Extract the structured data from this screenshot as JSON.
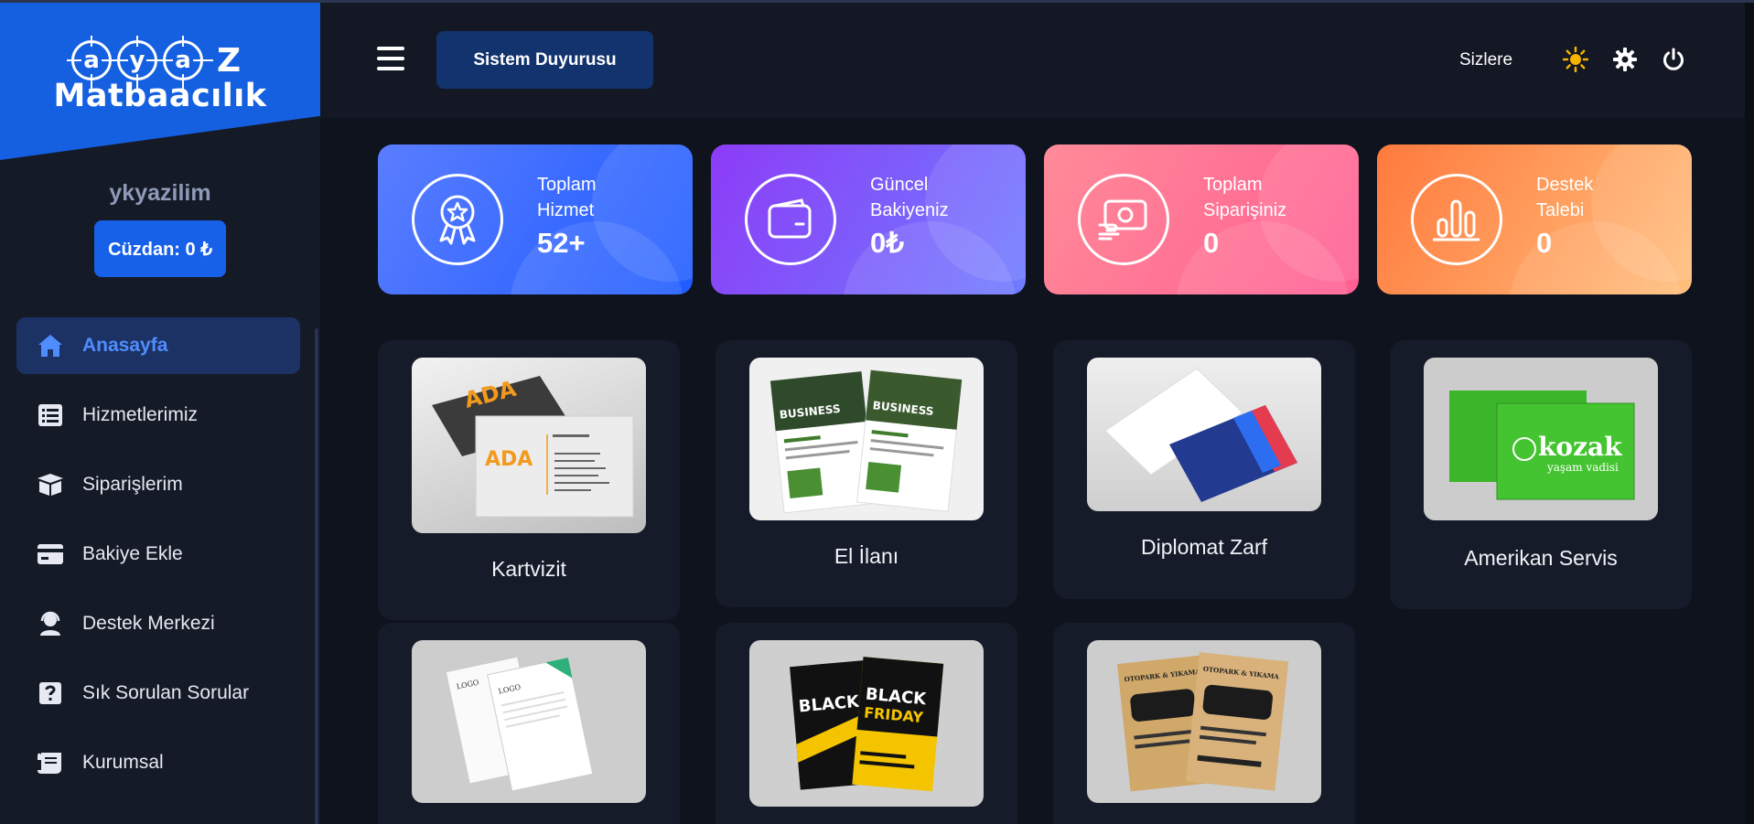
{
  "brand": {
    "logo_top_letters": [
      "a",
      "y",
      "a",
      "z"
    ],
    "logo_bottom": "Matbaacılık"
  },
  "user": {
    "name": "ykyazilim",
    "wallet_label": "Cüzdan: 0 ₺"
  },
  "sidebar": {
    "items": [
      {
        "label": "Anasayfa",
        "icon": "home-icon",
        "active": true
      },
      {
        "label": "Hizmetlerimiz",
        "icon": "list-icon",
        "active": false
      },
      {
        "label": "Siparişlerim",
        "icon": "box-icon",
        "active": false
      },
      {
        "label": "Bakiye Ekle",
        "icon": "credit-card-icon",
        "active": false
      },
      {
        "label": "Destek Merkezi",
        "icon": "headset-icon",
        "active": false
      },
      {
        "label": "Sık Sorulan Sorular",
        "icon": "question-icon",
        "active": false
      },
      {
        "label": "Kurumsal",
        "icon": "scroll-icon",
        "active": false
      }
    ]
  },
  "header": {
    "announcement_button": "Sistem Duyurusu",
    "marquee_text": "Sizlere",
    "icons": [
      "sun-icon",
      "gear-icon",
      "power-icon"
    ]
  },
  "stats": [
    {
      "label": "Toplam Hizmet",
      "value": "52+",
      "icon": "award-icon"
    },
    {
      "label": "Güncel Bakiyeniz",
      "value": "0₺",
      "icon": "wallet-icon"
    },
    {
      "label": "Toplam Siparişiniz",
      "value": "0",
      "icon": "money-icon"
    },
    {
      "label": "Destek Talebi",
      "value": "0",
      "icon": "bars-icon"
    }
  ],
  "services": [
    {
      "title": "Kartvizit"
    },
    {
      "title": "El İlanı"
    },
    {
      "title": "Diplomat Zarf"
    },
    {
      "title": "Amerikan Servis"
    },
    {
      "title": ""
    },
    {
      "title": ""
    },
    {
      "title": ""
    }
  ],
  "thumb_texts": {
    "ada": "ADA",
    "business": "BUSINESS",
    "black": "BLACK",
    "friday": "FRIDAY",
    "kozak": "kozak",
    "kozak_sub": "yaşam vadisi",
    "logo": "LOGO",
    "otopark": "OTOPARK & YIKAMA"
  },
  "colors": {
    "accent": "#1760e8",
    "active_nav_bg": "#1c3264",
    "active_nav_text": "#4f8dff",
    "sun": "#f5b400"
  }
}
